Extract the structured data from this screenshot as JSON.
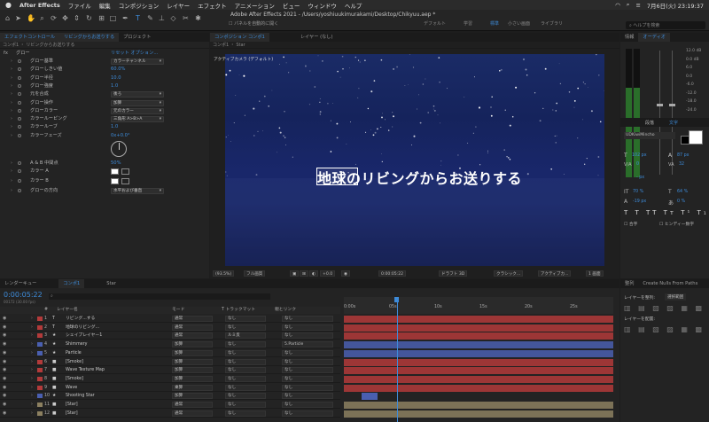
{
  "menubar": {
    "apple": "",
    "app": "After Effects",
    "items": [
      "ファイル",
      "編集",
      "コンポジション",
      "レイヤー",
      "エフェクト",
      "アニメーション",
      "ビュー",
      "ウィンドウ",
      "ヘルプ"
    ],
    "clock": "7月6日(火)  23:19:37"
  },
  "window": {
    "title": "Adobe After Effects 2021 - /Users/yoshiuukimurakami/Desktop/Chikyuu.aep *",
    "auto_open": "パネルを自動的に開く",
    "workspaces": [
      "デフォルト",
      "学習",
      "標準",
      "小さい画面",
      "ライブラリ"
    ],
    "active_workspace": "標準",
    "help_placeholder": "ヘルプを検索"
  },
  "effects": {
    "tabs": [
      "エフェクトコントロール",
      "リビングからお送りする",
      "プロジェクト"
    ],
    "crumb": "コンポ1 ・ リビングからお送りする",
    "fx_name": "グロー",
    "fx_links": "リセット  オプション...",
    "rows": [
      {
        "name": "グロー基準",
        "kind": "dd",
        "value": "カラーチャンネル"
      },
      {
        "name": "グローしきい値",
        "kind": "val",
        "value": "60.0%"
      },
      {
        "name": "グロー半径",
        "kind": "val",
        "value": "10.0"
      },
      {
        "name": "グロー強度",
        "kind": "val",
        "value": "1.0"
      },
      {
        "name": "元を合成",
        "kind": "dd",
        "value": "後ろ"
      },
      {
        "name": "グロー操作",
        "kind": "dd",
        "value": "加算"
      },
      {
        "name": "グローカラー",
        "kind": "dd",
        "value": "元のカラー"
      },
      {
        "name": "カラールーピング",
        "kind": "dd",
        "value": "三角形 A>B>A"
      },
      {
        "name": "カラールーブ",
        "kind": "val",
        "value": "1.0"
      },
      {
        "name": "カラーフェーズ",
        "kind": "val",
        "value": "0x+0.0°"
      },
      {
        "name": "",
        "kind": "dial",
        "value": ""
      },
      {
        "name": "A & B 中間点",
        "kind": "val",
        "value": "50%"
      },
      {
        "name": "カラー A",
        "kind": "swatch",
        "value": ""
      },
      {
        "name": "カラー B",
        "kind": "swatch",
        "value": ""
      },
      {
        "name": "グローの方向",
        "kind": "dd",
        "value": "水平および垂直"
      }
    ]
  },
  "comp": {
    "tabs": [
      "コンポジション  コンポ1",
      "レイヤー (なし)"
    ],
    "subtab": "コンポ1  ・ Star",
    "camera": "アクティブカメラ (デフォルト)",
    "caption": "地球のリビングからお送りする",
    "footer": [
      "(93.5%)",
      "フル画質",
      "0:00:05:22",
      "ドラフト 3D",
      "クラシック...",
      "アクティブカ...",
      "1 画面",
      "+0.0"
    ]
  },
  "right": {
    "tabs": [
      "情報",
      "オーディオ"
    ],
    "db": [
      "12.0 dB",
      "0.0 dB",
      "6.0",
      "0.0",
      "-6.0",
      "-12.0",
      "-18.0",
      "-24.0"
    ],
    "char_tabs": [
      "段落",
      "文字"
    ],
    "font": "UDKiwiMincho",
    "size": "102 px",
    "leading": "87 px",
    "kern": "0",
    "track": "32",
    "scale_v": "70 %",
    "scale_h": "64 %",
    "baseline": "-19 px",
    "tsume": "0 %",
    "px": "- px",
    "opts": [
      "合字",
      "ヒンディー数字"
    ]
  },
  "timeline": {
    "tabs": [
      "レンダーキュー",
      "コンポ1",
      "Star"
    ],
    "timecode": "0:00:05:22",
    "fps": "00172 (30.00 fps)",
    "headers": [
      "#",
      "レイヤー名",
      "モード",
      "T トラックマット",
      "親とリンク"
    ],
    "ruler": [
      "0:00s",
      "05s",
      "10s",
      "15s",
      "20s",
      "25s"
    ],
    "layers": [
      {
        "n": "1",
        "type": "T",
        "name": "リビング...する",
        "mode": "通常",
        "matte": "なし",
        "parent": "なし",
        "color": "#b33a3a"
      },
      {
        "n": "2",
        "type": "T",
        "name": "地球のリビング...",
        "mode": "通常",
        "matte": "なし",
        "parent": "なし",
        "color": "#b33a3a"
      },
      {
        "n": "3",
        "type": "★",
        "name": "シェイプレイヤー1",
        "mode": "通常",
        "matte": "ルミ反",
        "parent": "なし",
        "color": "#b33a3a"
      },
      {
        "n": "4",
        "type": "★",
        "name": "Shimmery",
        "mode": "加算",
        "matte": "なし",
        "parent": "5.Particle",
        "color": "#4a5fb0"
      },
      {
        "n": "5",
        "type": "★",
        "name": "Particle",
        "mode": "加算",
        "matte": "なし",
        "parent": "なし",
        "color": "#4a5fb0"
      },
      {
        "n": "6",
        "type": "■",
        "name": "[Smoke]",
        "mode": "加算",
        "matte": "なし",
        "parent": "なし",
        "color": "#b33a3a"
      },
      {
        "n": "7",
        "type": "■",
        "name": "Wave Texture Map",
        "mode": "加算",
        "matte": "なし",
        "parent": "なし",
        "color": "#b33a3a"
      },
      {
        "n": "8",
        "type": "■",
        "name": "[Smoke]",
        "mode": "加算",
        "matte": "なし",
        "parent": "なし",
        "color": "#b33a3a"
      },
      {
        "n": "9",
        "type": "■",
        "name": "Wave",
        "mode": "乗算",
        "matte": "なし",
        "parent": "なし",
        "color": "#b33a3a"
      },
      {
        "n": "10",
        "type": "★",
        "name": "Shooting Star",
        "mode": "加算",
        "matte": "なし",
        "parent": "なし",
        "color": "#4a5fb0"
      },
      {
        "n": "11",
        "type": "■",
        "name": "[Star]",
        "mode": "通常",
        "matte": "なし",
        "parent": "なし",
        "color": "#8c8060"
      },
      {
        "n": "12",
        "type": "■",
        "name": "[Star]",
        "mode": "通常",
        "matte": "なし",
        "parent": "なし",
        "color": "#8c8060"
      }
    ]
  },
  "align": {
    "tabs": [
      "整列",
      "Create Nulls From Paths"
    ],
    "label1": "レイヤーを整列:",
    "label2": "レイヤーを配置:",
    "target": "選択範囲"
  }
}
